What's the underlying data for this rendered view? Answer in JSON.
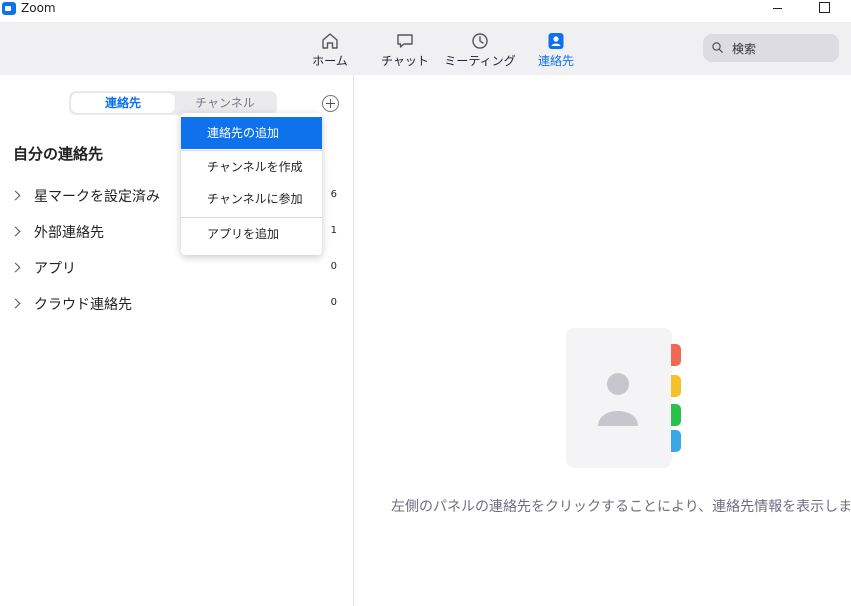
{
  "window": {
    "title": "Zoom"
  },
  "topnav": {
    "tabs": [
      {
        "label": "ホーム",
        "icon": "home-icon"
      },
      {
        "label": "チャット",
        "icon": "chat-icon"
      },
      {
        "label": "ミーティング",
        "icon": "clock-icon"
      },
      {
        "label": "連絡先",
        "icon": "contacts-icon",
        "active": true
      }
    ],
    "search": {
      "label": "検索"
    }
  },
  "leftpanel": {
    "segments": [
      "連絡先",
      "チャンネル"
    ],
    "section_title": "自分の連絡先",
    "groups": [
      {
        "label": "星マークを設定済み",
        "count": "6"
      },
      {
        "label": "外部連絡先",
        "count": "1"
      },
      {
        "label": "アプリ",
        "count": "0"
      },
      {
        "label": "クラウド連絡先",
        "count": "0"
      }
    ]
  },
  "dropdown": {
    "items": [
      "連絡先の追加",
      "チャンネルを作成",
      "チャンネルに参加",
      "アプリを追加"
    ]
  },
  "rightpanel": {
    "empty_message": "左側のパネルの連絡先をクリックすることにより、連絡先情報を表示します。"
  },
  "colors": {
    "accent": "#0e72ed",
    "tab_red": "#ef6a52",
    "tab_yellow": "#f5c12b",
    "tab_green": "#27c24c",
    "tab_blue": "#3aa6e8"
  }
}
